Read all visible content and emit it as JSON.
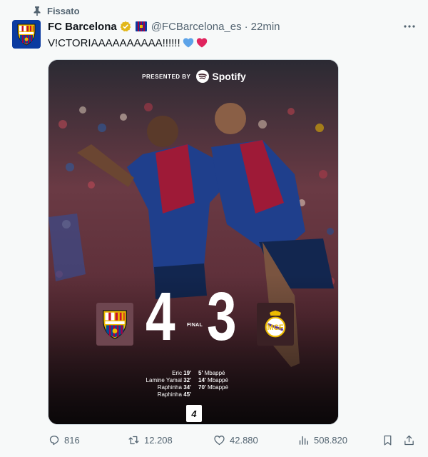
{
  "pinned": {
    "label": "Fissato"
  },
  "author": {
    "name": "FC Barcelona",
    "handle": "@FCBarcelona_es",
    "separator": "·",
    "time": "22min"
  },
  "tweet": {
    "text": "V!CTORIAAAAAAAAAA!!!!!! "
  },
  "media": {
    "presented_by": "PRESENTED BY",
    "sponsor": "Spotify",
    "score_home": "4",
    "score_away": "3",
    "final_label": "FINAL",
    "home_scorers": [
      {
        "name": "Eric",
        "minute": "19'"
      },
      {
        "name": "Lamine Yamal",
        "minute": "32'"
      },
      {
        "name": "Raphinha",
        "minute": "34'"
      },
      {
        "name": "Raphinha",
        "minute": "45'"
      }
    ],
    "away_scorers": [
      {
        "minute": "5'",
        "name": "Mbappé"
      },
      {
        "minute": "14'",
        "name": "Mbappé"
      },
      {
        "minute": "70'",
        "name": "Mbappé"
      }
    ],
    "league_mark": "4"
  },
  "actions": {
    "replies": "816",
    "retweets": "12.208",
    "likes": "42.880",
    "views": "508.820"
  },
  "colors": {
    "blue_heart": "#5da3e8",
    "red_heart": "#e0245e",
    "verified": "#e2b719",
    "barca_blue": "#0b3ba0",
    "barca_red": "#a50044"
  },
  "icons": [
    "pin-icon",
    "verified-badge-icon",
    "flag-icon",
    "more-icon",
    "blue-heart-icon",
    "red-heart-icon",
    "spotify-icon",
    "reply-icon",
    "retweet-icon",
    "like-icon",
    "views-icon",
    "bookmark-icon",
    "share-icon"
  ]
}
